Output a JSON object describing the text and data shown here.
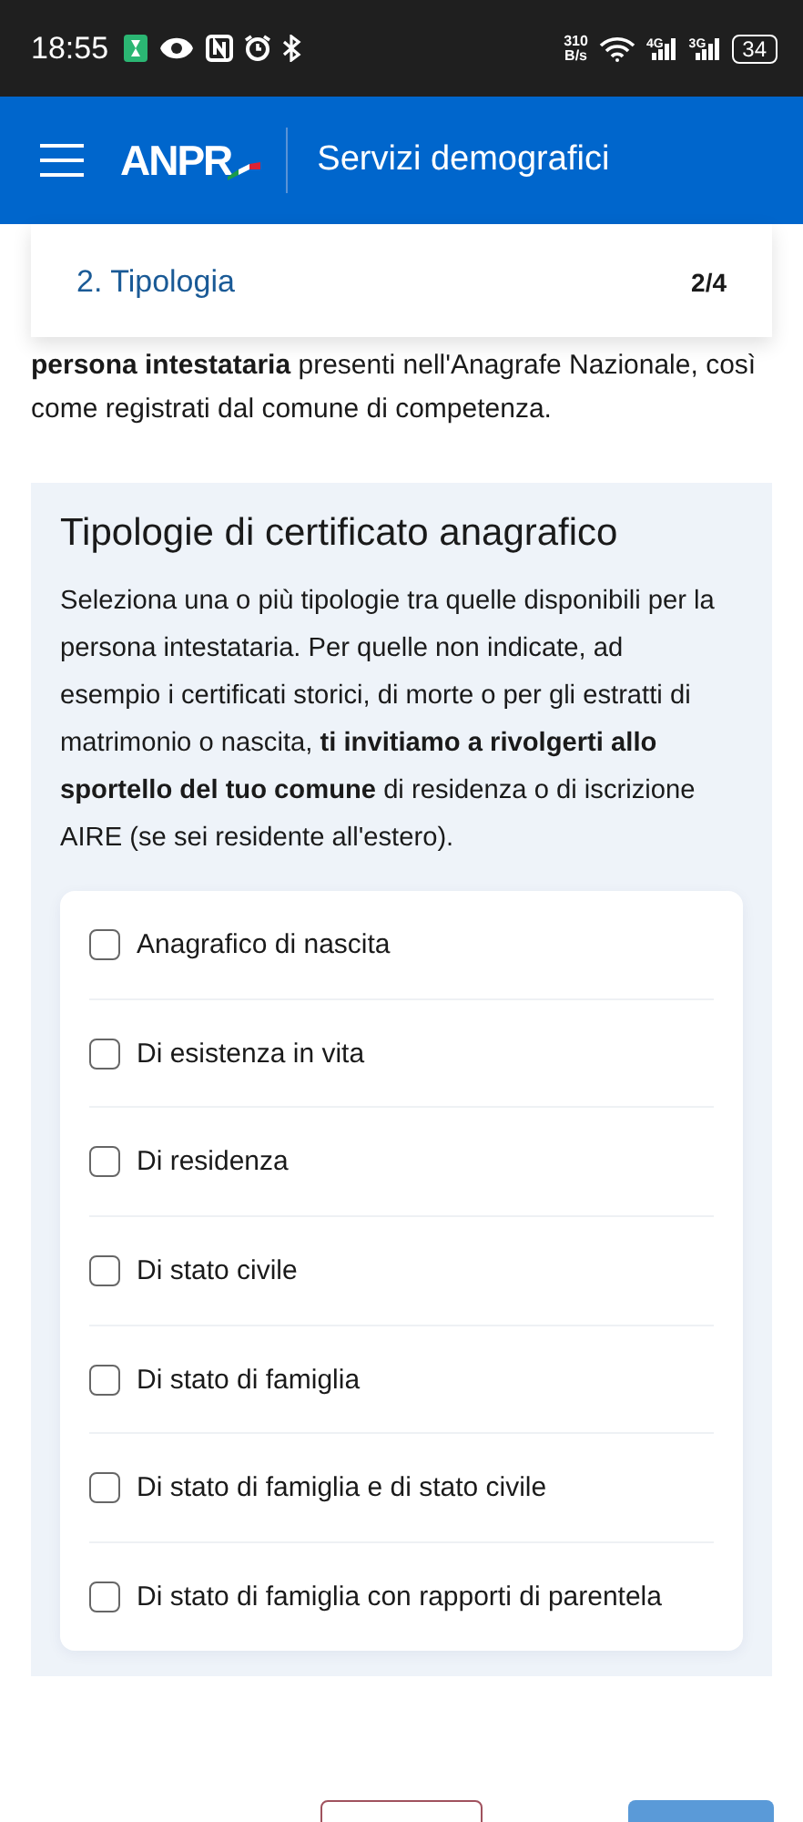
{
  "status_bar": {
    "time": "18:55",
    "speed_value": "310",
    "speed_unit": "B/s",
    "networks": [
      "4G",
      "3G"
    ],
    "battery": "34"
  },
  "header": {
    "brand": "ANPR",
    "title": "Servizi demografici"
  },
  "step": {
    "label": "2. Tipologia",
    "counter": "2/4"
  },
  "intro": "**persona intestataria** presenti nell'Anagrafe Nazionale, così come registrati dal comune di competenza.",
  "section": {
    "title": "Tipologie di certificato anagrafico",
    "description": "Seleziona una o più tipologie tra quelle disponibili per la persona intestataria. Per quelle non indicate, ad esempio i certificati storici, di morte o per gli estratti di matrimonio o nascita, **ti invitiamo a rivolgerti allo sportello del tuo comune** di residenza o di iscrizione AIRE (se sei residente all'estero).",
    "options": [
      {
        "label": "Anagrafico di nascita",
        "checked": false
      },
      {
        "label": "Di esistenza in vita",
        "checked": false
      },
      {
        "label": "Di residenza",
        "checked": false
      },
      {
        "label": "Di stato civile",
        "checked": false
      },
      {
        "label": "Di stato di famiglia",
        "checked": false
      },
      {
        "label": "Di stato di famiglia e di stato civile",
        "checked": false
      },
      {
        "label": "Di stato di famiglia con rapporti di parentela",
        "checked": false
      }
    ]
  },
  "buttons": [
    {
      "kind": "secondary"
    },
    {
      "kind": "primary"
    }
  ]
}
